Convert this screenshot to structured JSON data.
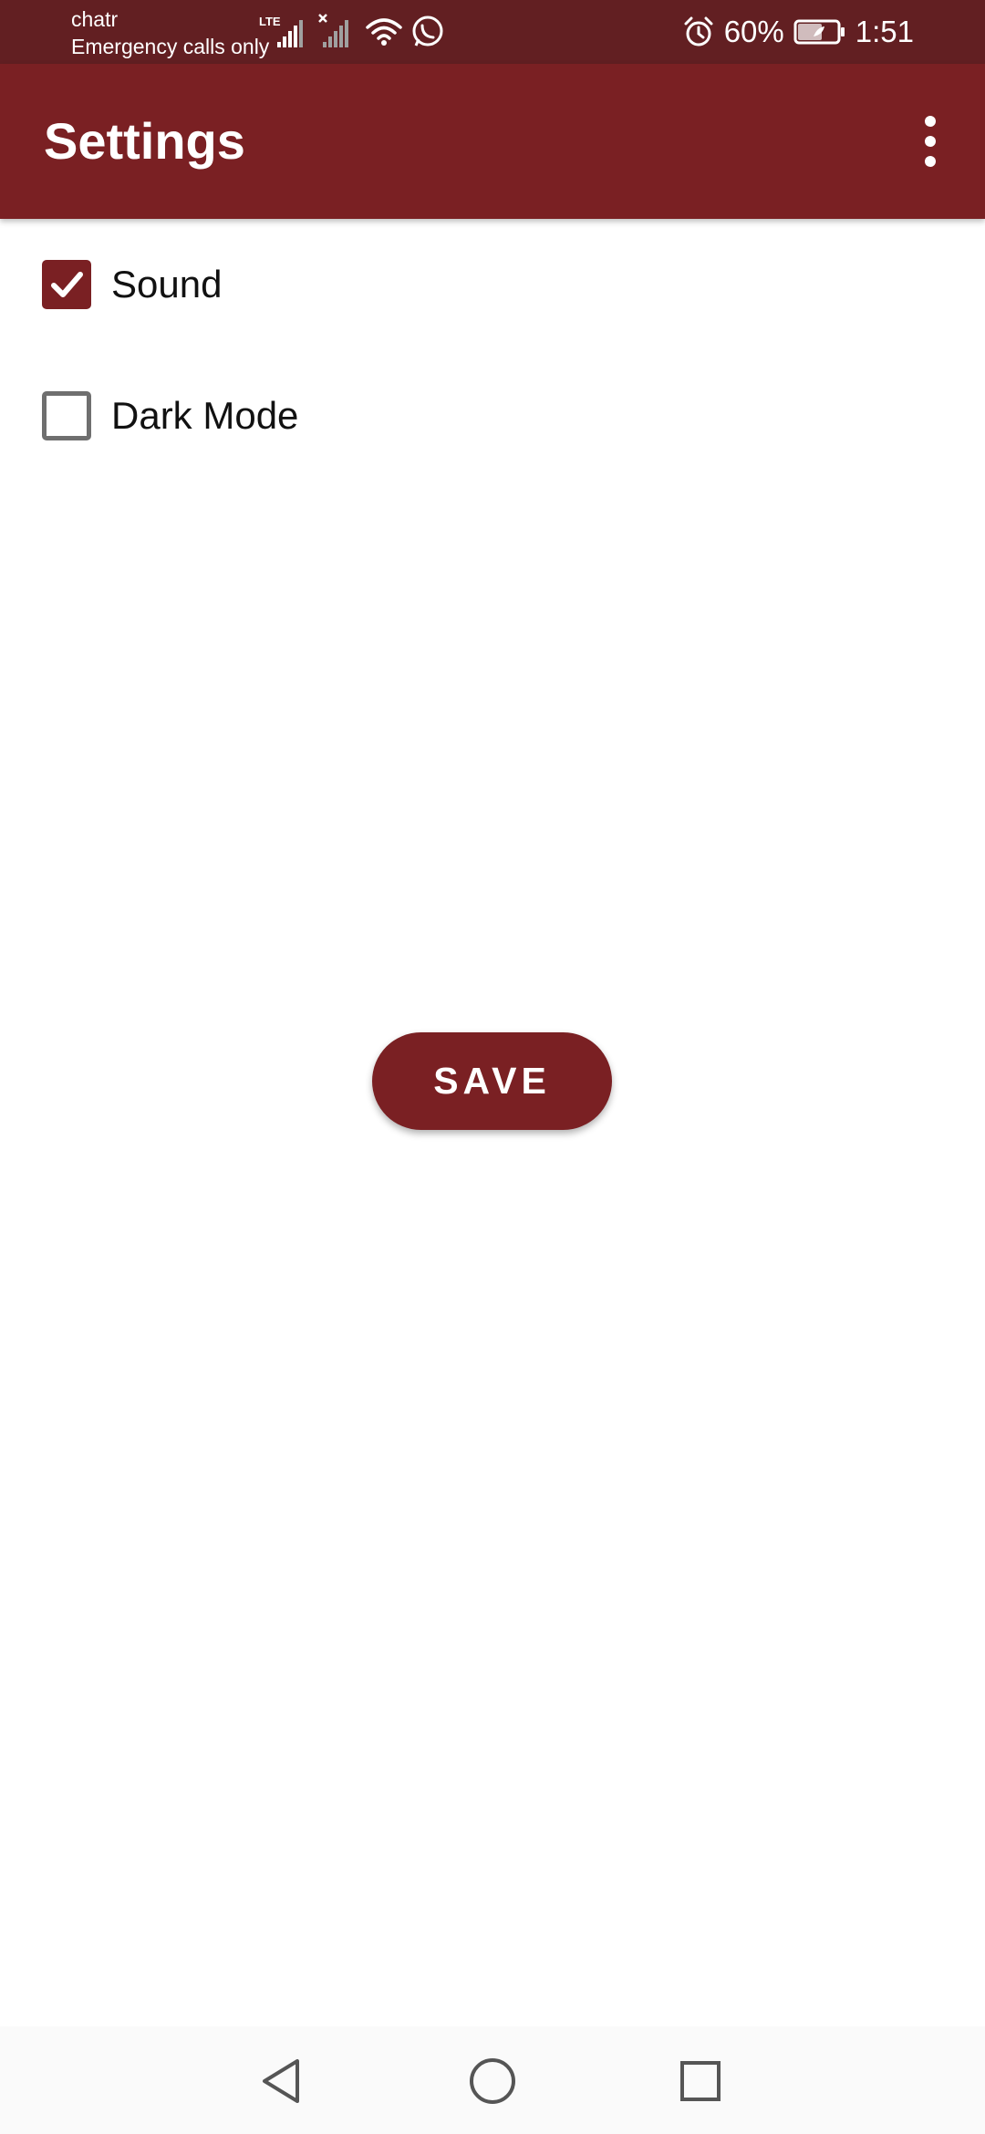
{
  "status_bar": {
    "carrier": "chatr",
    "carrier_status": "Emergency calls only",
    "network_type": "LTE",
    "battery_percent": "60%",
    "time": "1:51",
    "icons": [
      "lte-signal-icon",
      "no-signal-icon",
      "wifi-icon",
      "whatsapp-icon",
      "alarm-icon",
      "battery-icon"
    ]
  },
  "app_bar": {
    "title": "Settings",
    "menu_icon": "more-vert-icon"
  },
  "settings": {
    "sound": {
      "label": "Sound",
      "checked": true
    },
    "dark_mode": {
      "label": "Dark Mode",
      "checked": false
    }
  },
  "save_button": {
    "label": "SAVE"
  },
  "nav_bar": {
    "buttons": [
      "back-icon",
      "home-icon",
      "recents-icon"
    ]
  },
  "colors": {
    "status_bar": "#621f22",
    "app_bar": "#7a2023",
    "accent": "#7a2023",
    "text": "#111111"
  }
}
